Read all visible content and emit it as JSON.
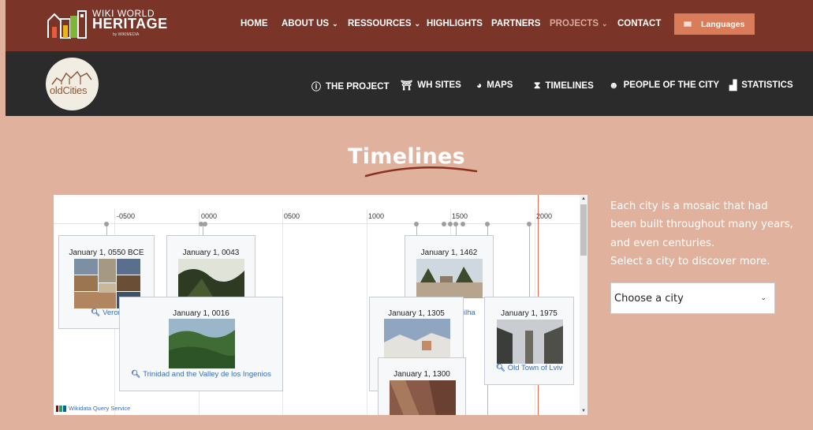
{
  "topbar": {
    "logo": {
      "line1": "WIKI WORLD",
      "line2": "HERITAGE",
      "line3": "by WIKIMEDIA"
    },
    "nav": [
      "HOME",
      "ABOUT US",
      "RESSOURCES",
      "HIGHLIGHTS",
      "PARTNERS",
      "PROJECTS",
      "CONTACT"
    ],
    "chevron": "⌄",
    "languages_label": "Languages",
    "colors": {
      "background": "#7a3428",
      "active_item": "#d9aa9c",
      "languages_button": "#d97c59"
    }
  },
  "subbar": {
    "logo_text": "oldCities",
    "nav": [
      {
        "label": "THE PROJECT",
        "icon": "info-icon"
      },
      {
        "label": "WH SITES",
        "icon": "monument-icon"
      },
      {
        "label": "MAPS",
        "icon": "globe-icon"
      },
      {
        "label": "TIMELINES",
        "icon": "hourglass-icon"
      },
      {
        "label": "PEOPLE OF THE CITY",
        "icon": "users-icon"
      },
      {
        "label": "STATISTICS",
        "icon": "chart-icon"
      }
    ],
    "colors": {
      "background": "#2b2b2b"
    }
  },
  "main": {
    "title": "Timelines",
    "colors": {
      "background": "#e0b19c",
      "underline": "#8b2f22"
    }
  },
  "timeline": {
    "years": [
      "-0500",
      "0000",
      "0500",
      "1000",
      "1500",
      "2000"
    ],
    "cards": [
      {
        "date": "January 1, 0550 BCE",
        "link": "Veron"
      },
      {
        "date": "January 1, 0043",
        "link": ""
      },
      {
        "date": "January 1, 0016",
        "link": "Trinidad and the Valley de los Ingenios"
      },
      {
        "date": "January 1, 1462",
        "link": "ilha"
      },
      {
        "date": "January 1, 1305",
        "link": ""
      },
      {
        "date": "January 1, 1975",
        "link": "Old Town of Lviv"
      },
      {
        "date": "January 1, 1300",
        "link": ""
      }
    ],
    "footer": "Wikidata Query Service",
    "colors": {
      "marker_line": "#e06a4e",
      "link": "#3b6db5"
    }
  },
  "sidebar": {
    "intro": "Each city is a mosaic that had been built throughout many years, and even centuries.",
    "instruction": "Select a city to discover more.",
    "select": {
      "selected": "Choose a city"
    }
  }
}
